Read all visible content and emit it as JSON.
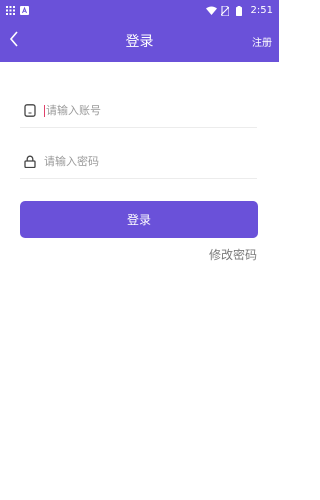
{
  "status_bar": {
    "time": "2:51",
    "icons": [
      "grid-icon",
      "a-badge-icon",
      "wifi-icon",
      "no-sim-icon",
      "battery-icon"
    ]
  },
  "nav": {
    "title": "登录",
    "register_label": "注册",
    "back_icon": "chevron-left-icon"
  },
  "form": {
    "account": {
      "placeholder": "请输入账号",
      "value": "",
      "icon": "phone-icon"
    },
    "password": {
      "placeholder": "请输入密码",
      "value": "",
      "icon": "lock-icon"
    }
  },
  "login_button_label": "登录",
  "change_password_label": "修改密码",
  "colors": {
    "primary": "#6a51d9",
    "white": "#ffffff",
    "muted_text": "#7a7a7a",
    "caret": "#e0406a"
  }
}
